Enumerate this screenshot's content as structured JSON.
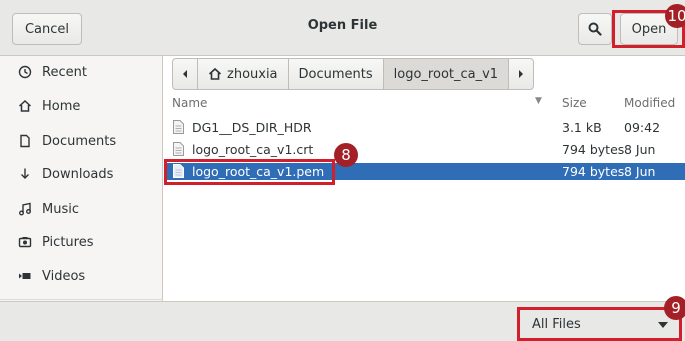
{
  "header": {
    "cancel_label": "Cancel",
    "title": "Open File",
    "open_label": "Open",
    "search_icon": "search-icon"
  },
  "annotations": {
    "open": "10",
    "file": "8",
    "filter": "9"
  },
  "sidebar": {
    "items": [
      {
        "label": "Recent",
        "icon": "clock-icon"
      },
      {
        "label": "Home",
        "icon": "home-icon"
      },
      {
        "label": "Documents",
        "icon": "document-icon"
      },
      {
        "label": "Downloads",
        "icon": "download-icon"
      },
      {
        "label": "Music",
        "icon": "music-icon"
      },
      {
        "label": "Pictures",
        "icon": "camera-icon"
      },
      {
        "label": "Videos",
        "icon": "video-icon"
      }
    ]
  },
  "pathbar": {
    "home": "zhouxia",
    "documents": "Documents",
    "current": "logo_root_ca_v1"
  },
  "filelist": {
    "columns": {
      "name": "Name",
      "size": "Size",
      "modified": "Modified"
    },
    "rows": [
      {
        "name": "DG1__DS_DIR_HDR",
        "size": "3.1 kB",
        "modified": "09:42",
        "selected": false
      },
      {
        "name": "logo_root_ca_v1.crt",
        "size": "794 bytes",
        "modified": "8 Jun",
        "selected": false
      },
      {
        "name": "logo_root_ca_v1.pem",
        "size": "794 bytes",
        "modified": "8 Jun",
        "selected": true
      }
    ]
  },
  "footer": {
    "filter_value": "All Files"
  },
  "colors": {
    "accent": "#2f6db6",
    "annotation_red": "#d11f2b",
    "badge": "#a32026"
  }
}
